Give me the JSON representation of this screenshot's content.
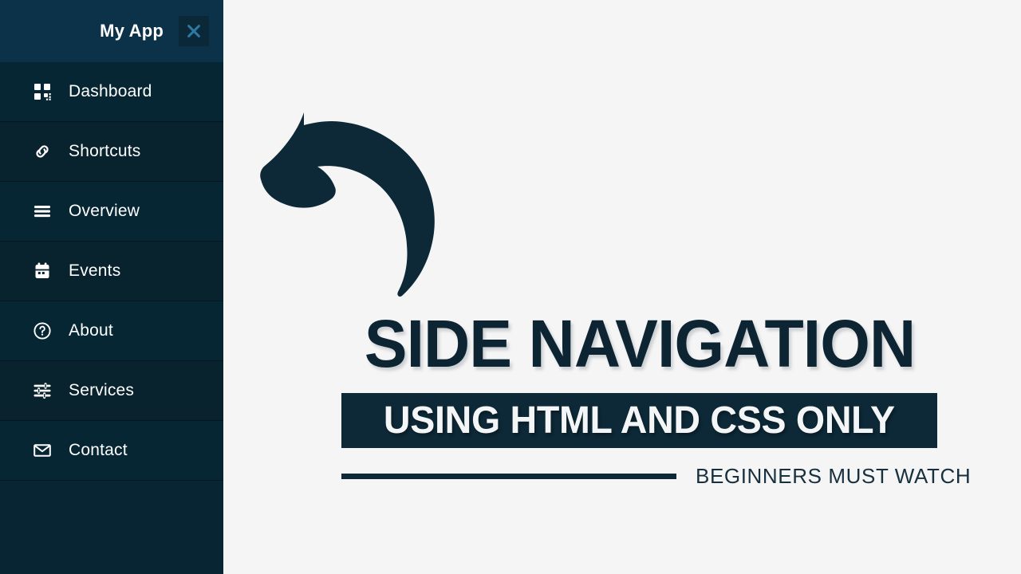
{
  "sidebar": {
    "brand_title": "My App",
    "close_icon": "close-x-icon",
    "background_color": "#07212e",
    "header_color": "#0b3249",
    "close_icon_color": "#2b7ba5",
    "items": [
      {
        "label": "Dashboard",
        "icon": "grid-dashboard-icon"
      },
      {
        "label": "Shortcuts",
        "icon": "link-chain-icon"
      },
      {
        "label": "Overview",
        "icon": "list-lines-icon"
      },
      {
        "label": "Events",
        "icon": "calendar-icon"
      },
      {
        "label": "About",
        "icon": "question-circle-icon"
      },
      {
        "label": "Services",
        "icon": "sliders-tune-icon"
      },
      {
        "label": "Contact",
        "icon": "envelope-mail-icon"
      }
    ]
  },
  "main": {
    "arrow_icon": "curved-arrow-up-left-icon",
    "headline": "SIDE NAVIGATION",
    "subtitle": "USING HTML AND CSS ONLY",
    "footer_text": "BEGINNERS MUST WATCH",
    "accent_color": "#0d2836",
    "background_color": "#f5f5f5"
  }
}
